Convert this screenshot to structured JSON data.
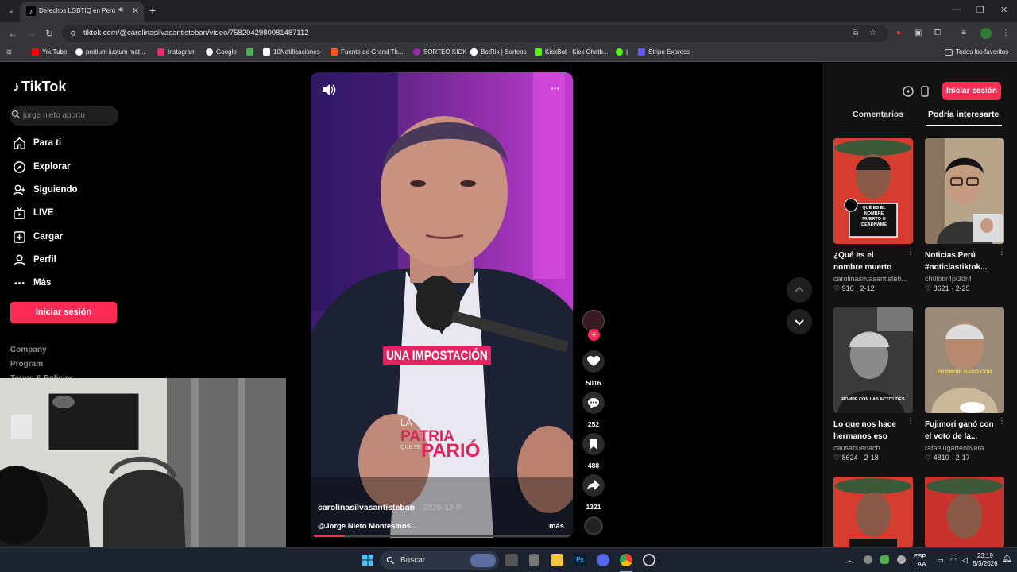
{
  "browser": {
    "tab_title": "Derechos LGBTIQ en Perú c",
    "url": "tiktok.com/@carolinasilvasantisteban/video/7582042980081487112",
    "bookmarks": [
      {
        "label": "YouTube",
        "color": "#ff0000"
      },
      {
        "label": "pretium iustum mat...",
        "color": "#ffffff"
      },
      {
        "label": "Instagram",
        "color": "#e1306c"
      },
      {
        "label": "Google",
        "color": "#ffffff"
      },
      {
        "label": "",
        "color": "#4caf50"
      },
      {
        "label": "10Notificaciones",
        "color": "#ffffff"
      },
      {
        "label": "Fuente de Grand Th...",
        "color": "#ff5722"
      },
      {
        "label": "SORTEO KICK",
        "color": "#9c27b0"
      },
      {
        "label": "BotRix | Sorteos",
        "color": "#ffffff"
      },
      {
        "label": "KickBot - Kick Chatb...",
        "color": "#53fc18"
      },
      {
        "label": "|",
        "color": "#53fc18"
      },
      {
        "label": "Stripe Express",
        "color": "#635bff"
      }
    ],
    "all_favorites": "Todos los favoritos"
  },
  "tiktok": {
    "logo": "TikTok",
    "search_placeholder": "jorge nieto aborto",
    "nav": [
      {
        "label": "Para ti",
        "icon": "home-icon"
      },
      {
        "label": "Explorar",
        "icon": "compass-icon"
      },
      {
        "label": "Siguiendo",
        "icon": "following-icon"
      },
      {
        "label": "LIVE",
        "icon": "live-icon"
      },
      {
        "label": "Cargar",
        "icon": "upload-icon"
      },
      {
        "label": "Perfil",
        "icon": "profile-icon"
      },
      {
        "label": "Más",
        "icon": "more-icon"
      }
    ],
    "login_label": "Iniciar sesión",
    "footer_links": [
      "Company",
      "Program",
      "Terms & Policies"
    ],
    "video": {
      "caption": "UNA IMPOSTACIÓN",
      "overlay_small_1": "LA",
      "overlay_big_1": "PATRIA",
      "overlay_small_2": "QUE TE",
      "overlay_big_2": "PARIÓ",
      "author": "carolinasilvasantisteban",
      "date": "· 2025-12-9",
      "description": "@Jorge Nieto Montesinos...",
      "more": "más",
      "progress": 0.13,
      "likes": "5016",
      "comments": "252",
      "saves": "488",
      "shares": "1321"
    }
  },
  "right_panel": {
    "login_label": "Iniciar sesión",
    "tab_comments": "Comentarios",
    "tab_recommended": "Podría interesarte",
    "cards": [
      {
        "title": "¿Qué es el nombre muerto o...",
        "author": "carolinasilvasantisteb...",
        "likes": "916",
        "date": "2-12",
        "thumb_text": "QUÉ ES EL NOMBRE MUERTO O DEADNAME"
      },
      {
        "title": "Noticias Perú #noticiastiktok...",
        "author": "ch0lotir4pi3dr4",
        "likes": "8621",
        "date": "2-25",
        "thumb_text": ""
      },
      {
        "title": "Lo que nos hace hermanos eso se...",
        "author": "causabuenacb",
        "likes": "8624",
        "date": "2-18",
        "thumb_text": "ROMPE CON LAS ACTITUDES"
      },
      {
        "title": "Fujimori ganó con el voto de la...",
        "author": "rafaelugarteolivera",
        "likes": "4810",
        "date": "2-17",
        "thumb_text": "FUJIMORI GANÓ CON"
      }
    ]
  },
  "taskbar": {
    "search_label": "Buscar",
    "lang_1": "ESP",
    "lang_2": "LAA",
    "time": "23:19",
    "date": "5/3/2026"
  }
}
